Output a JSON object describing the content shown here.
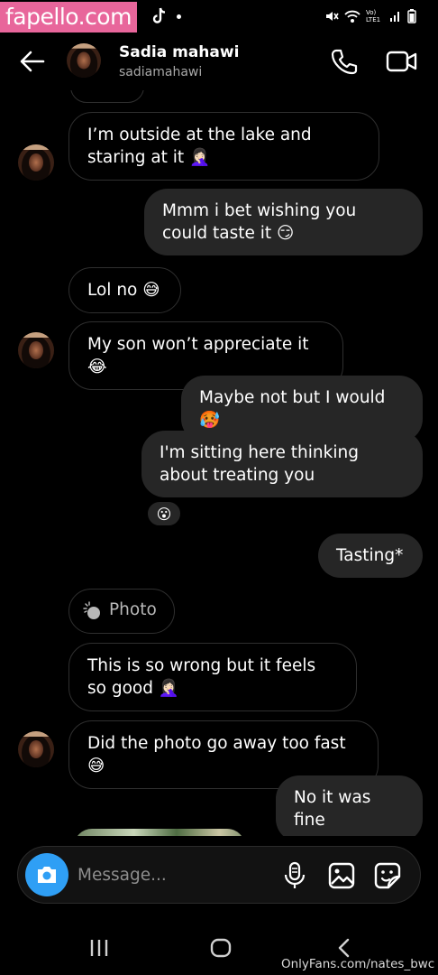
{
  "status_bar": {
    "watermark": "fapello.com",
    "network_label": "Vo) LTE1",
    "icons": [
      "tiktok-icon",
      "mute-icon",
      "wifi-icon",
      "signal-icon",
      "battery-icon"
    ]
  },
  "header": {
    "name": "Sadia mahawi",
    "username": "sadiamahawi",
    "icons": [
      "back-arrow-icon",
      "phone-icon",
      "video-call-icon"
    ]
  },
  "messages": [
    {
      "side": "in",
      "text": "I’m outside at the lake and staring at it 🤦🏻‍♀️"
    },
    {
      "side": "out",
      "text": "Mmm i bet wishing you could taste it 😏"
    },
    {
      "side": "in",
      "text": "Lol no 😅"
    },
    {
      "side": "in",
      "text": "My son won’t appreciate it 😂"
    },
    {
      "side": "out",
      "text": "Maybe not but I would 🥵"
    },
    {
      "side": "out",
      "text": "I'm sitting here thinking about treating you",
      "reaction": "😮"
    },
    {
      "side": "out",
      "text": "Tasting*"
    },
    {
      "side": "in",
      "type": "photo",
      "text": "Photo"
    },
    {
      "side": "in",
      "text": "This is so wrong but it feels so good 🤦🏻‍♀️"
    },
    {
      "side": "in",
      "text": "Did the photo go away too fast 😅"
    },
    {
      "side": "out",
      "text": "No it was fine"
    }
  ],
  "composer": {
    "placeholder": "Message...",
    "icons": [
      "camera-icon",
      "microphone-icon",
      "gallery-icon",
      "sticker-icon"
    ]
  },
  "nav_bar": {
    "icons": [
      "recent-apps-icon",
      "home-icon",
      "back-icon"
    ]
  },
  "bottom_watermark": "OnlyFans.com/nates_bwc",
  "colors": {
    "background": "#000000",
    "outgoing_bubble": "#262626",
    "incoming_border": "#2f2f2f",
    "camera_button": "#2f9ff5",
    "watermark_bg": "#e8669b",
    "secondary_text": "#a8a8a8"
  }
}
